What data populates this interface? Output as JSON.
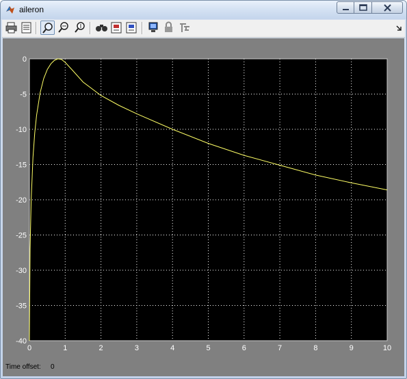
{
  "window": {
    "title": "aileron"
  },
  "toolbar": {
    "buttons": [
      {
        "icon": "print-icon"
      },
      {
        "icon": "parameters-icon"
      },
      {
        "icon": "zoom-icon",
        "active": true
      },
      {
        "icon": "zoom-x-icon"
      },
      {
        "icon": "zoom-y-icon"
      },
      {
        "icon": "autoscale-icon"
      },
      {
        "icon": "save-axes-icon"
      },
      {
        "icon": "restore-axes-icon"
      },
      {
        "icon": "floating-scope-icon"
      },
      {
        "icon": "lock-icon"
      },
      {
        "icon": "signal-selection-icon"
      }
    ]
  },
  "status": {
    "time_offset_label": "Time offset:",
    "time_offset_value": "0"
  },
  "colors": {
    "plot_bg": "#000000",
    "figure_bg": "#808080",
    "line": "#ffff66",
    "grid": "#ffffff"
  },
  "chart_data": {
    "type": "line",
    "title": "",
    "xlabel": "",
    "ylabel": "",
    "xlim": [
      0,
      10
    ],
    "ylim": [
      -40,
      0
    ],
    "grid": true,
    "x_ticks": [
      "0",
      "1",
      "2",
      "3",
      "4",
      "5",
      "6",
      "7",
      "8",
      "9",
      "10"
    ],
    "y_ticks": [
      "0",
      "-5",
      "-10",
      "-15",
      "-20",
      "-25",
      "-30",
      "-35",
      "-40"
    ],
    "series": [
      {
        "x": [
          0,
          0.02,
          0.05,
          0.1,
          0.15,
          0.2,
          0.3,
          0.4,
          0.5,
          0.6,
          0.7,
          0.8,
          0.9,
          1.0,
          1.2,
          1.5,
          2.0,
          2.5,
          3.0,
          4.0,
          5.0,
          6.0,
          7.0,
          8.0,
          9.0,
          10.0
        ],
        "y": [
          -40,
          -27,
          -20,
          -14,
          -10.5,
          -8,
          -4.8,
          -2.8,
          -1.5,
          -0.7,
          -0.2,
          0,
          -0.1,
          -0.5,
          -1.6,
          -3.3,
          -5.2,
          -6.6,
          -7.8,
          -10.0,
          -12.0,
          -13.7,
          -15.1,
          -16.5,
          -17.6,
          -18.6
        ]
      }
    ]
  }
}
